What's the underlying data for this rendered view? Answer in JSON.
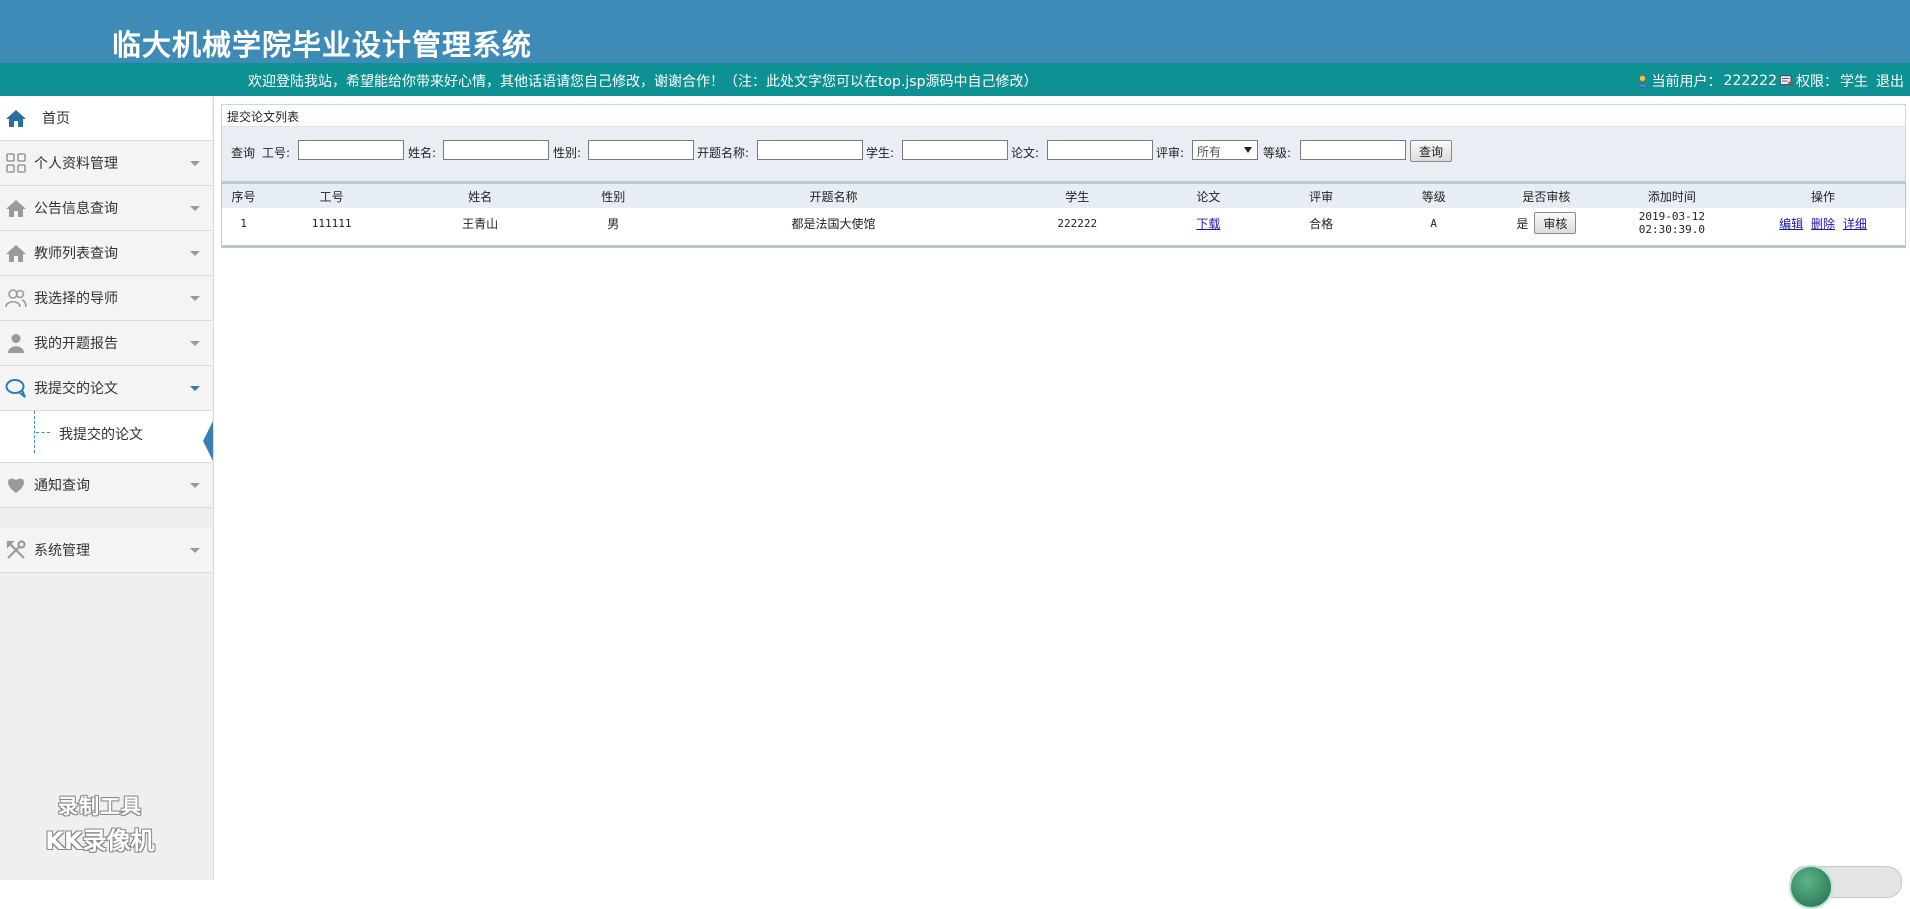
{
  "app": {
    "title": "临大机械学院毕业设计管理系统"
  },
  "infobar": {
    "welcome": "欢迎登陆我站，希望能给你带来好心情，其他话语请您自己修改，谢谢合作！（注：此处文字您可以在top.jsp源码中自己修改）",
    "current_user_label": "当前用户：",
    "current_user": "222222",
    "role_label": "权限：",
    "role": "学生",
    "logout": "退出"
  },
  "sidebar": {
    "items": [
      {
        "label": "首页",
        "icon": "home-icon"
      },
      {
        "label": "个人资料管理",
        "icon": "grid-icon"
      },
      {
        "label": "公告信息查询",
        "icon": "house-icon"
      },
      {
        "label": "教师列表查询",
        "icon": "house-icon"
      },
      {
        "label": "我选择的导师",
        "icon": "users-icon"
      },
      {
        "label": "我的开题报告",
        "icon": "user-icon"
      },
      {
        "label": "我提交的论文",
        "icon": "chat-icon"
      },
      {
        "label": "通知查询",
        "icon": "heart-icon"
      },
      {
        "label": "系统管理",
        "icon": "tools-icon"
      }
    ],
    "submenu_label": "我提交的论文",
    "watermark_line1": "录制工具",
    "watermark_line2": "KK录像机"
  },
  "panel": {
    "title": "提交论文列表"
  },
  "search": {
    "query_label": "查询",
    "gh_label": "工号:",
    "name_label": "姓名:",
    "gender_label": "性别:",
    "topic_label": "开题名称:",
    "student_label": "学生:",
    "paper_label": "论文:",
    "review_label": "评审:",
    "review_value": "所有",
    "grade_label": "等级:",
    "search_button": "查询"
  },
  "table": {
    "headers": [
      "序号",
      "工号",
      "姓名",
      "性别",
      "开题名称",
      "学生",
      "论文",
      "评审",
      "等级",
      "是否审核",
      "添加时间",
      "操作"
    ],
    "rows": [
      {
        "index": "1",
        "gh": "111111",
        "name": "王青山",
        "gender": "男",
        "topic": "都是法国大使馆",
        "student": "222222",
        "paper": "下载",
        "review": "合格",
        "grade": "A",
        "audited": "是",
        "audit_button": "审核",
        "added_time": "2019-03-12 02:30:39.0",
        "op_edit": "编辑",
        "op_delete": "删除",
        "op_detail": "详细"
      }
    ]
  },
  "colors": {
    "header_blue": "#3d8bb6",
    "infobar_teal": "#0d9192",
    "accent": "#2f7fb0"
  }
}
